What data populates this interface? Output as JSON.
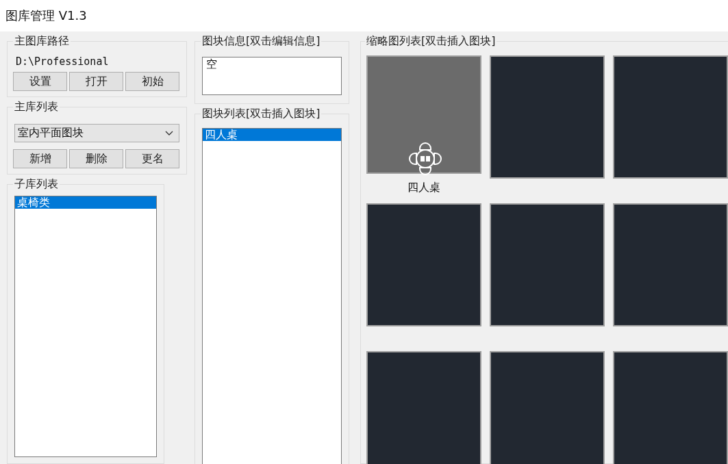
{
  "window": {
    "title": "图库管理 V1.3"
  },
  "main_path": {
    "legend": "主图库路径",
    "path": "D:\\Professional",
    "buttons": [
      "设置",
      "打开",
      "初始"
    ]
  },
  "main_library": {
    "legend": "主库列表",
    "dropdown": {
      "value": "室内平面图块"
    },
    "buttons": [
      "新增",
      "删除",
      "更名"
    ]
  },
  "sub_library": {
    "legend": "子库列表",
    "items": [
      {
        "label": "桌椅类",
        "selected": true
      }
    ]
  },
  "block_info": {
    "legend": "图块信息[双击编辑信息]",
    "value": "空"
  },
  "block_list": {
    "legend": "图块列表[双击插入图块]",
    "items": [
      {
        "label": "四人桌",
        "selected": true
      }
    ]
  },
  "thumbnails": {
    "legend": "缩略图列表[双击插入图块]",
    "items": [
      {
        "kind": "drawing",
        "label": "四人桌",
        "selected": true
      },
      {
        "kind": "empty",
        "selected": false
      },
      {
        "kind": "empty",
        "selected": false
      },
      {
        "kind": "empty",
        "selected": false
      },
      {
        "kind": "empty",
        "selected": false
      },
      {
        "kind": "empty",
        "selected": false
      },
      {
        "kind": "empty",
        "selected": false
      },
      {
        "kind": "empty",
        "selected": false
      },
      {
        "kind": "empty",
        "selected": false
      }
    ]
  }
}
